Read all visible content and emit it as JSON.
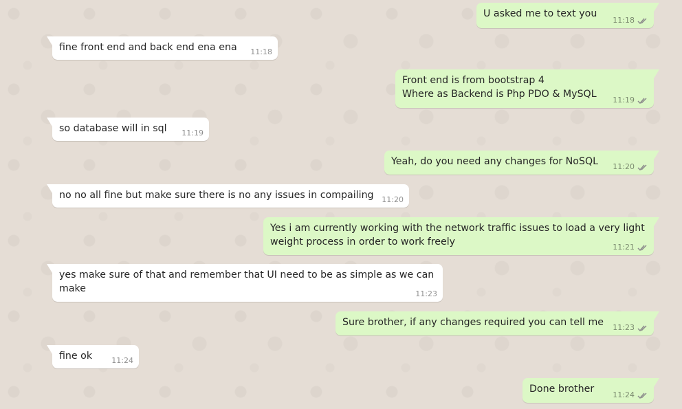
{
  "messages": [
    {
      "direction": "out",
      "text": "U asked me to text you",
      "time": "11:18"
    },
    {
      "direction": "in",
      "text": "fine front end and back end ena ena",
      "time": "11:18"
    },
    {
      "direction": "out",
      "text": "Front end is from bootstrap 4\nWhere as Backend is Php PDO & MySQL",
      "time": "11:19"
    },
    {
      "direction": "in",
      "text": "so database will in sql",
      "time": "11:19"
    },
    {
      "direction": "out",
      "text": "Yeah, do you need any changes for NoSQL",
      "time": "11:20"
    },
    {
      "direction": "in",
      "text": "no no all fine but make sure there is no any issues in compailing",
      "time": "11:20"
    },
    {
      "direction": "out",
      "text": "Yes i am currently working with the network traffic issues to load a very light weight process in order to work freely",
      "time": "11:21"
    },
    {
      "direction": "in",
      "text": "yes make sure of that and remember that UI need to be as simple as we can make",
      "time": "11:23"
    },
    {
      "direction": "out",
      "text": "Sure brother, if any changes required you can tell me",
      "time": "11:23"
    },
    {
      "direction": "in",
      "text": "fine ok",
      "time": "11:24"
    },
    {
      "direction": "out",
      "text": "Done brother",
      "time": "11:24"
    }
  ],
  "colors": {
    "background": "#e5ddd5",
    "incoming_bubble": "#ffffff",
    "outgoing_bubble": "#dcf8c6",
    "timestamp": "#8c8c8c",
    "read_receipt": "#8c8c8c"
  },
  "icons": {
    "read_receipt": "double-check-icon"
  }
}
